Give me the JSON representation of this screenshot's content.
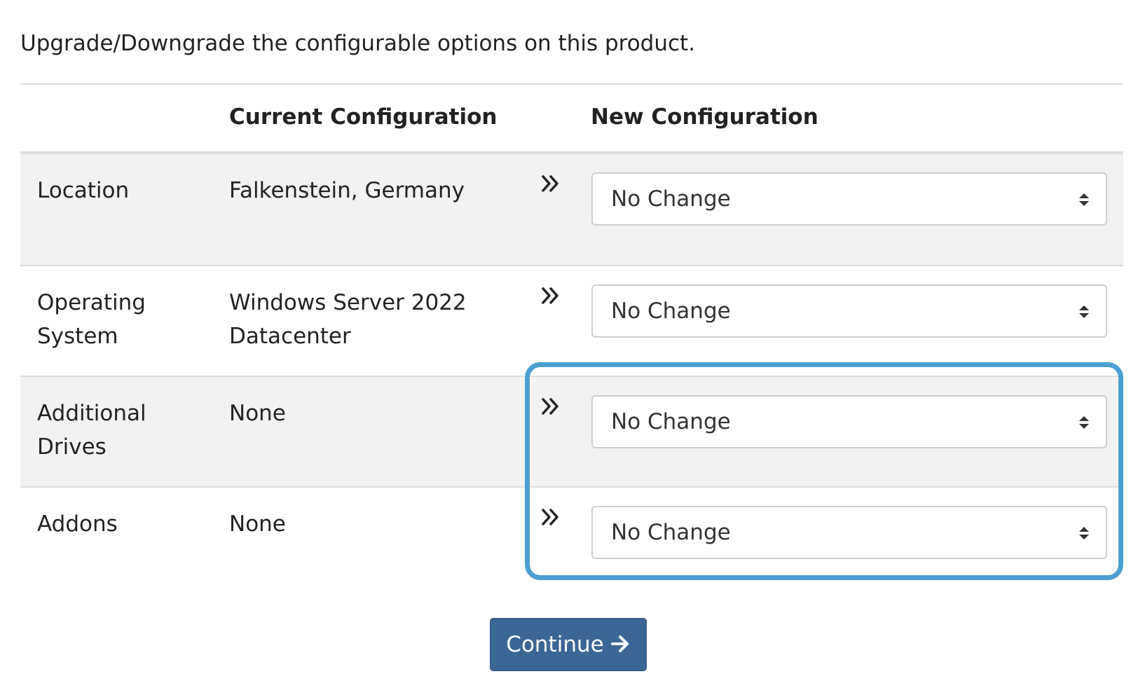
{
  "intro_text": "Upgrade/Downgrade the configurable options on this product.",
  "table": {
    "headers": {
      "current": "Current Configuration",
      "new": "New Configuration"
    },
    "rows": [
      {
        "label": "Location",
        "current": "Falkenstein, Germany",
        "new_value": "No Change"
      },
      {
        "label": "Operating System",
        "current": "Windows Server 2022 Datacenter",
        "new_value": "No Change"
      },
      {
        "label": "Additional Drives",
        "current": "None",
        "new_value": "No Change"
      },
      {
        "label": "Addons",
        "current": "None",
        "new_value": "No Change"
      }
    ]
  },
  "continue_button": {
    "label": "Continue"
  },
  "colors": {
    "text": "#222222",
    "row_shade": "#f2f2f2",
    "divider": "#dedede",
    "select_border": "#cfcfcf",
    "highlight": "#4aa0d2",
    "button_bg": "#3c6696",
    "button_text": "#ffffff"
  },
  "icons": {
    "row_arrow": "double-chevron-right-icon",
    "select_caret": "sort-caret-icon",
    "button_arrow": "arrow-right-icon"
  }
}
